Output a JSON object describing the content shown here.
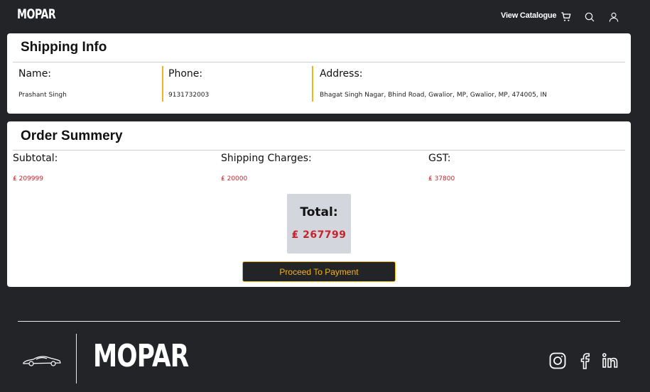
{
  "header": {
    "logo": "MOPAR",
    "nav_link": "View Catalogue",
    "icons": [
      "cart-icon",
      "search-icon",
      "user-icon"
    ]
  },
  "shipping": {
    "title": "Shipping Info",
    "name_label": "Name:",
    "name_value": "Prashant Singh",
    "phone_label": "Phone:",
    "phone_value": "9131732003",
    "address_label": "Address:",
    "address_value": "Bhagat Singh Nagar, Bhind Road, Gwalior, MP, Gwalior, MP, 474005, IN"
  },
  "summary": {
    "title": "Order Summery",
    "subtotal_label": "Subtotal:",
    "subtotal_value": "₤ 209999",
    "shipping_label": "Shipping Charges:",
    "shipping_value": "₤ 20000",
    "gst_label": "GST:",
    "gst_value": "₤ 37800",
    "total_label": "Total:",
    "total_value": "₤ 267799",
    "pay_button": "Proceed To Payment"
  },
  "footer": {
    "logo": "MOPAR",
    "social_icons": [
      "instagram-icon",
      "facebook-icon",
      "linkedin-icon"
    ]
  },
  "colors": {
    "background": "#222428",
    "accent_yellow": "#f0b323",
    "price_red": "#c8232c",
    "total_box": "#d3d6dc"
  }
}
